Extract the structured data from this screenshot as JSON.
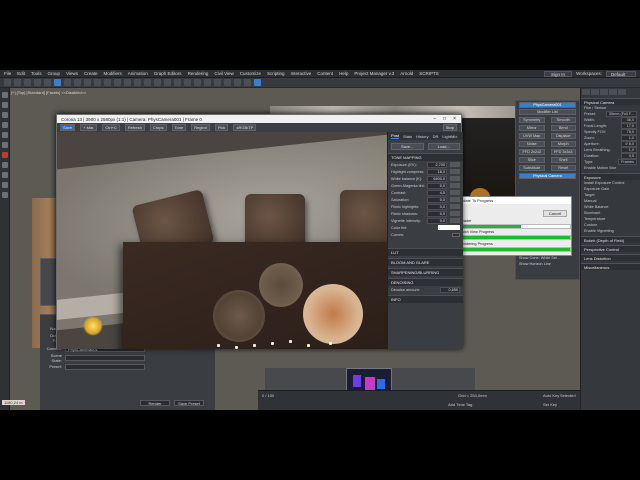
{
  "colors": {
    "accent": "#3d7fc7",
    "progress": "#1db935",
    "letterbox": "#000000"
  },
  "menubar": {
    "items": [
      "File",
      "Edit",
      "Tools",
      "Group",
      "Views",
      "Create",
      "Modifiers",
      "Animation",
      "Graph Editors",
      "Rendering",
      "Civil View",
      "Customize",
      "Scripting",
      "Interactive",
      "Content",
      "Help",
      "Project Manager v.3",
      "Arnold",
      "SCRIPTS"
    ],
    "sign_in": "Sign In",
    "workspaces_label": "Workspaces:",
    "workspace_value": "Default"
  },
  "viewport": {
    "label": "[+] [Top] [Standard] [Facets] <<Disabled>>"
  },
  "vfb": {
    "title": "Corona 13 | 3900 x 2580px (1:1) | Camera: PhysCamera001 | Frame 0",
    "toolbar": [
      "Save",
      "+ Mar.",
      "Ctrl+C",
      "Refresh",
      "Crops",
      "Tone",
      "Region",
      "Pick",
      "sRGB/TP"
    ],
    "stop": "Stop",
    "tabs": [
      "Post",
      "Stats",
      "History",
      "DR",
      "LightMix"
    ],
    "save_btn": "Save...",
    "load_btn": "Load...",
    "section_tone": "TONE MAPPING",
    "params": [
      {
        "name": "Exposure (EV):",
        "value": "2,700"
      },
      {
        "name": "Highlight compress:",
        "value": "16,0"
      },
      {
        "name": "White balance [K]:",
        "value": "6400,0"
      },
      {
        "name": "Green-Magenta tint:",
        "value": "0,0"
      },
      {
        "name": "Contrast:",
        "value": "4,5"
      },
      {
        "name": "Saturation:",
        "value": "0,0"
      },
      {
        "name": "Filmic highlights:",
        "value": "0,0"
      },
      {
        "name": "Filmic shadows:",
        "value": "0,0"
      },
      {
        "name": "Vignette intensity:",
        "value": "0,0"
      }
    ],
    "color_tint": "Color tint:",
    "curves": "Curves:",
    "sections": [
      "LUT",
      "BLOOM AND GLARE",
      "SHARPENING/BLURRING",
      "DENOISING",
      "INFO"
    ],
    "denoise_label": "Denoise amount:",
    "denoise_value": "0,650"
  },
  "progress": {
    "title": "Update To Progress",
    "cancel": "Cancel",
    "bars": [
      {
        "label": "Header",
        "value": 0.55
      },
      {
        "label": "Batch View Progress",
        "value": 1.0
      },
      {
        "label": "Rendering Progress",
        "value": 1.0
      }
    ]
  },
  "modifier_list": {
    "title": "Modifier List",
    "buttons": [
      "Symmetry",
      "Smooth",
      "Mirror",
      "Bend",
      "UVW Map",
      "Displace",
      "Noise",
      "Morph",
      "FFD 2x2x2",
      "FFD 3x3x3",
      "Slice",
      "Shell",
      "Substitute",
      "Reset"
    ],
    "selected_object": "PhysCamera001",
    "stack_item": "Physical Camera"
  },
  "cmd_panel": {
    "header": "Physical Camera",
    "sub": "Film / Sensor",
    "props": [
      {
        "name": "Preset:",
        "value": "35mm (Full F..."
      },
      {
        "name": "Width:",
        "value": "36,0"
      },
      {
        "name": "Focal Length:",
        "value": "17,5"
      },
      {
        "name": "Specify FOV:",
        "value": "78,0"
      },
      {
        "name": "Zoom:",
        "value": "1,0"
      },
      {
        "name": "Aperture:",
        "value": "f/ 8,0"
      },
      {
        "name": "Lens Breathing:",
        "value": "1,0"
      },
      {
        "name": "Duration:",
        "value": "0,5"
      },
      {
        "name": "Type:",
        "value": "Frames"
      }
    ],
    "sections": [
      "Exposure",
      "Bokeh (Depth of Field)",
      "Perspective Control",
      "Lens Distortion",
      "Miscellaneous"
    ],
    "exposure_items": [
      "Install Exposure Control",
      "Exposure Gain",
      "Target",
      "Manual",
      "White Balance",
      "Illuminant",
      "Temperature",
      "Custom",
      "Enable Vignetting"
    ]
  },
  "target": {
    "targeted": "Targeted",
    "distance_label": "Target Distance:",
    "distance_value": "4980,37 t",
    "viewport_display": "Viewport Display",
    "show_cone": "Show Cone:",
    "cone_value": "While Sel...",
    "horizon": "Show Horizon Line",
    "enable_motion_blur": "Enable Motion Blur"
  },
  "render_setup": {
    "pixel_aspect_label": "Pixel Aspect:",
    "pixel_aspect_value": "1,0",
    "name_label": "Name:",
    "name_value": "Ploy design",
    "output_label": "Output Path:",
    "output_value": "C:\\...\\Kheema Rendrds\\1.jpg",
    "camera_label": "Camera:",
    "camera_value": "PhysCamera001",
    "scene_label": "Scene State:",
    "preset_label": "Preset:",
    "btn_render": "Render",
    "btn_save": "Save Preset"
  },
  "timeline": {
    "frame": "0 / 100",
    "grid": "Grid = 254,0mm",
    "add_tag": "Add Time Tag",
    "auto_key": "Auto Key",
    "selected": "Selected",
    "set_key": "Set Key",
    "filters": "Key Filters..."
  },
  "status": {
    "coords": "1180,24 m"
  }
}
